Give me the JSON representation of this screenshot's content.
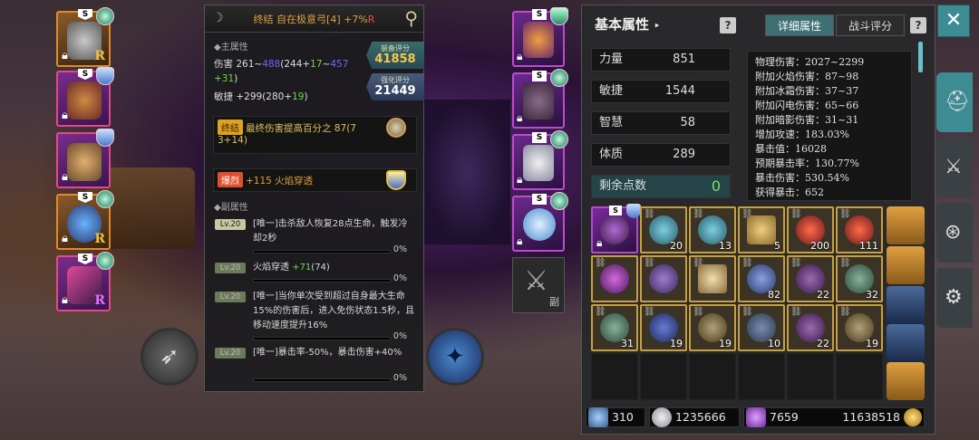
{
  "left_equipment": [
    {
      "slot": "helmet",
      "tag": "S",
      "grade": "R",
      "rarity": "gold"
    },
    {
      "slot": "armor",
      "tag": "S",
      "grade": "",
      "rarity": "purple"
    },
    {
      "slot": "necklace",
      "tag": "",
      "grade": "",
      "rarity": "purple"
    },
    {
      "slot": "ring",
      "tag": "S",
      "grade": "R",
      "rarity": "gold"
    },
    {
      "slot": "bow",
      "tag": "S",
      "grade": "R",
      "rarity": "purple"
    }
  ],
  "tooltip": {
    "title": "终结 自在极意弓[4] +7%",
    "title_suffix": "R",
    "main_section": "◆主属性",
    "dmg_prefix": "伤害 261~",
    "dmg_blue": "488",
    "dmg_mid": "(244+",
    "dmg_green": "17",
    "dmg_mid2": "~",
    "dmg_blue2": "457",
    "dmg_line2_plus": "+31",
    "dmg_line2_close": ")",
    "agi": "敏捷 +299(280+",
    "agi_green": "19",
    "agi_close": ")",
    "equip_score_label": "装备评分",
    "equip_score": "41858",
    "enhance_score_label": "强化评分",
    "enhance_score": "21449",
    "final_tag": "终结",
    "final_text": "最终伤害提高百分之 87(7",
    "final_text2": "3+14)",
    "burst_tag": "爆烈",
    "burst_text": "+115 火焰穿透",
    "sub_section": "◆副属性",
    "subs": [
      {
        "lv": "Lv.20",
        "text": "[唯一]击杀敌人恢复28点生命，触发冷却2秒",
        "pct": "0%"
      },
      {
        "lv": "Lv.20",
        "text": "火焰穿透 ",
        "green": "+71",
        "after": "(74)",
        "pct": "0%"
      },
      {
        "lv": "Lv.20",
        "text": "[唯一]当你单次受到超过自身最大生命15%的伤害后，进入免伤状态1.5秒，且移动速度提升16%",
        "pct": "0%"
      },
      {
        "lv": "Lv.20",
        "text": "[唯一]暴击率-50%，暴击伤害+40%",
        "pct": "0%"
      }
    ]
  },
  "mid_slots": [
    {
      "tag": "S",
      "badge": "shield"
    },
    {
      "tag": "S",
      "badge": "medal"
    },
    {
      "tag": "S",
      "badge": "medal"
    },
    {
      "tag": "S",
      "badge": "medal"
    }
  ],
  "secondary_weapon_label": "副",
  "panel": {
    "title": "基本属性",
    "title_arrow": "‣",
    "tab_detail": "详细属性",
    "tab_battle": "战斗评分",
    "q": "?",
    "attributes": [
      {
        "name": "力量",
        "value": "851"
      },
      {
        "name": "敏捷",
        "value": "1544"
      },
      {
        "name": "智慧",
        "value": "58"
      },
      {
        "name": "体质",
        "value": "289"
      }
    ],
    "remain_label": "剩余点数",
    "remain_value": "0",
    "details": [
      "物理伤害：2027~2299",
      "附加火焰伤害：87~98",
      "附加冰霜伤害：37~37",
      "附加闪电伤害：65~66",
      "附加暗影伤害：31~31",
      "增加攻速：183.03%",
      "暴击值：16028",
      "预期暴击率：130.77%",
      "暴击伤害：530.54%",
      "获得暴击：652"
    ]
  },
  "inventory": [
    {
      "type": "purple",
      "count": "",
      "tag": "S",
      "color": "#b06ad0"
    },
    {
      "type": "gold",
      "count": "20",
      "color": "#3a8aa0"
    },
    {
      "type": "gold",
      "count": "13",
      "color": "#3a8aa0"
    },
    {
      "type": "gold",
      "count": "5",
      "color": "#c8a050"
    },
    {
      "type": "gold",
      "count": "200",
      "color": "#c83a2a"
    },
    {
      "type": "gold",
      "count": "111",
      "color": "#c83a2a"
    },
    {
      "type": "gold",
      "count": "",
      "color": "#9a3ab0"
    },
    {
      "type": "gold",
      "count": "",
      "color": "#6a4aa0"
    },
    {
      "type": "gold",
      "count": "",
      "color": "#c8a060"
    },
    {
      "type": "gold",
      "count": "82",
      "color": "#4a6ad0"
    },
    {
      "type": "gold",
      "count": "22",
      "color": "#6a3a8a"
    },
    {
      "type": "gold",
      "count": "32",
      "color": "#4a6a5a"
    },
    {
      "type": "gold",
      "count": "31",
      "color": "#4a6a5a"
    },
    {
      "type": "gold",
      "count": "19",
      "color": "#3a4a8a"
    },
    {
      "type": "gold",
      "count": "19",
      "color": "#6a5a3a"
    },
    {
      "type": "gold",
      "count": "10",
      "color": "#3a4a6a"
    },
    {
      "type": "gold",
      "count": "22",
      "color": "#6a3a8a"
    },
    {
      "type": "gold",
      "count": "19",
      "color": "#6a5a3a"
    }
  ],
  "currency": {
    "arrows": "310",
    "silver": "1235666",
    "crystal": "7659",
    "gold": "11638518"
  },
  "close": "✕"
}
